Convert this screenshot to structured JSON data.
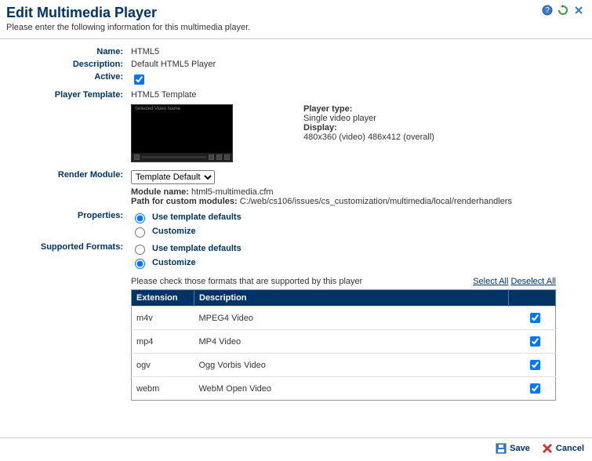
{
  "header": {
    "title": "Edit Multimedia Player",
    "subtitle": "Please enter the following information for this multimedia player."
  },
  "labels": {
    "name": "Name:",
    "description": "Description:",
    "active": "Active:",
    "playerTemplate": "Player Template:",
    "renderModule": "Render Module:",
    "properties": "Properties:",
    "supportedFormats": "Supported Formats:"
  },
  "values": {
    "name": "HTML5",
    "description": "Default HTML5 Player",
    "activeChecked": true,
    "playerTemplate": "HTML5 Template"
  },
  "preview": {
    "titleText": "Selected Video Name"
  },
  "playerInfo": {
    "typeLabel": "Player type:",
    "typeValue": "Single video player",
    "displayLabel": "Display:",
    "displayValue": "480x360 (video) 486x412 (overall)"
  },
  "renderModule": {
    "selected": "Template Default",
    "moduleNameLabel": "Module name:",
    "moduleNameValue": "html5-multimedia.cfm",
    "customPathLabel": "Path for custom modules:",
    "customPathValue": "C:/web/cs106/issues/cs_customization/multimedia/local/renderhandlers"
  },
  "properties": {
    "useDefaults": "Use template defaults",
    "customize": "Customize",
    "selected": "useDefaults"
  },
  "formats": {
    "useDefaults": "Use template defaults",
    "customize": "Customize",
    "selected": "customize"
  },
  "formatsSection": {
    "instruction": "Please check those formats that are supported by this player",
    "selectAll": "Select All",
    "deselectAll": "Deselect All",
    "columns": {
      "extension": "Extension",
      "description": "Description"
    },
    "rows": [
      {
        "ext": "m4v",
        "desc": "MPEG4 Video",
        "checked": true
      },
      {
        "ext": "mp4",
        "desc": "MP4 Video",
        "checked": true
      },
      {
        "ext": "ogv",
        "desc": "Ogg Vorbis Video",
        "checked": true
      },
      {
        "ext": "webm",
        "desc": "WebM Open Video",
        "checked": true
      }
    ]
  },
  "footer": {
    "save": "Save",
    "cancel": "Cancel"
  }
}
